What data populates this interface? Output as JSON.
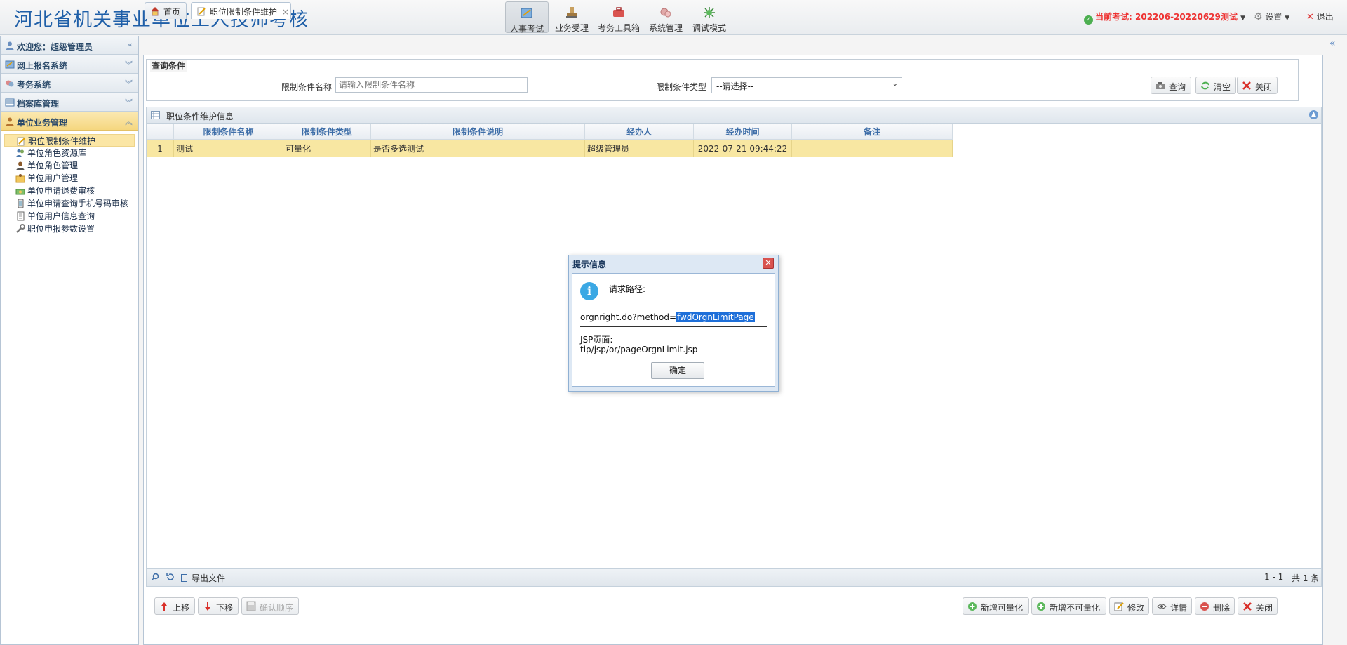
{
  "header": {
    "app_title": "河北省机关事业单位工人技师考核",
    "nav": [
      {
        "label": "人事考试",
        "icon": "exam-icon"
      },
      {
        "label": "业务受理",
        "icon": "stamp-icon"
      },
      {
        "label": "考务工具箱",
        "icon": "toolbox-icon"
      },
      {
        "label": "系统管理",
        "icon": "system-icon"
      },
      {
        "label": "调试模式",
        "icon": "debug-icon"
      }
    ],
    "current_exam_label": "当前考试:",
    "current_exam_value": "202206-20220629测试",
    "settings_label": "设置",
    "logout_label": "退出"
  },
  "sidebar": {
    "welcome": "欢迎您：超级管理员",
    "sections": [
      {
        "label": "网上报名系统"
      },
      {
        "label": "考务系统"
      },
      {
        "label": "档案库管理"
      },
      {
        "label": "单位业务管理"
      }
    ],
    "items": [
      {
        "label": "职位限制条件维护"
      },
      {
        "label": "单位角色资源库"
      },
      {
        "label": "单位角色管理"
      },
      {
        "label": "单位用户管理"
      },
      {
        "label": "单位申请退费审核"
      },
      {
        "label": "单位申请查询手机号码审核"
      },
      {
        "label": "单位用户信息查询"
      },
      {
        "label": "职位申报参数设置"
      }
    ]
  },
  "tabs": [
    {
      "label": "首页"
    },
    {
      "label": "职位限制条件维护",
      "close": "×"
    }
  ],
  "query": {
    "legend": "查询条件",
    "name_label": "限制条件名称",
    "name_placeholder": "请输入限制条件名称",
    "type_label": "限制条件类型",
    "type_selected": "--请选择--",
    "search_btn": "查询",
    "clear_btn": "清空",
    "close_btn": "关闭"
  },
  "grid": {
    "title": "职位条件维护信息",
    "columns": [
      "限制条件名称",
      "限制条件类型",
      "限制条件说明",
      "经办人",
      "经办时间",
      "备注"
    ],
    "rows": [
      {
        "index": "1",
        "name": "测试",
        "type": "可量化",
        "desc": "是否多选测试",
        "operator": "超级管理员",
        "time": "2022-07-21 09:44:22",
        "remark": ""
      }
    ],
    "export_label": "导出文件",
    "pager_range": "1 - 1",
    "pager_total": "共 1 条"
  },
  "bottom": {
    "up": "上移",
    "down": "下移",
    "confirm_order": "确认顺序",
    "add_quant": "新增可量化",
    "add_nonquant": "新增不可量化",
    "edit": "修改",
    "detail": "详情",
    "delete": "删除",
    "close": "关闭"
  },
  "dialog": {
    "title": "提示信息",
    "request_label": "请求路径:",
    "path_prefix": "orgnright.do?method=",
    "path_method": "fwdOrgnLimitPage",
    "jsp_label": "JSP页面:",
    "jsp_path": "tip/jsp/or/pageOrgnLimit.jsp",
    "ok": "确定"
  },
  "colors": {
    "title_blue": "#1f5fa8",
    "exam_red": "#e33333",
    "selected_row": "#f8e7a2",
    "highlight": "#1e6fd9"
  }
}
